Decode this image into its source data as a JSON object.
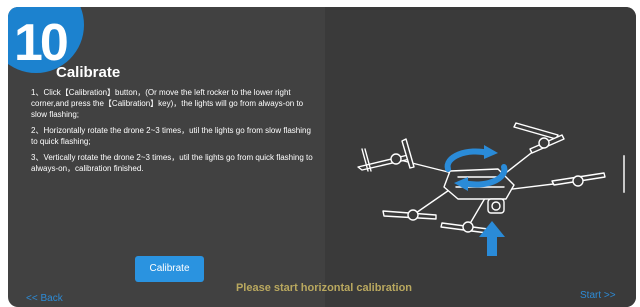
{
  "step": {
    "number": "10",
    "title": "Calibrate"
  },
  "instructions": [
    "1、Click【Calibration】button，(Or move the left rocker to the lower right corner,and press the【Calibration】key)，the lights will go from always-on to slow flashing;",
    "2、Horizontally rotate the drone 2~3 times，util the lights go from slow flashing to quick flashing;",
    "3、Vertically rotate the drone 2~3 times，util the lights go from quick flashing to always-on，calibration finished."
  ],
  "calibrate_button": "Calibrate",
  "status_text": "Please start horizontal calibration",
  "nav": {
    "back": "<< Back",
    "start": "Start >>"
  },
  "colors": {
    "accent": "#1c82cf",
    "status": "#b9a85f",
    "panel_bg": "#414141"
  },
  "icons": {
    "rotate": "rotate-arrows-icon",
    "arrow_up": "arrow-up-icon"
  }
}
